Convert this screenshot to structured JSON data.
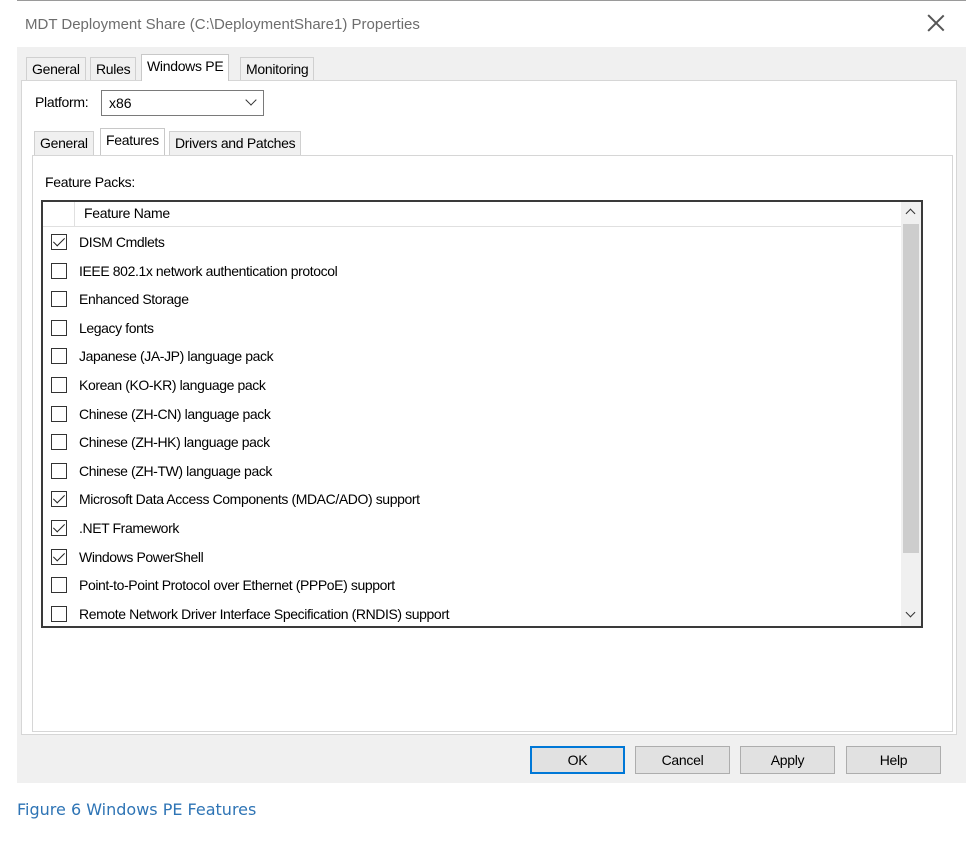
{
  "window": {
    "title": "MDT Deployment Share (C:\\DeploymentShare1) Properties"
  },
  "main_tabs": [
    {
      "label": "General"
    },
    {
      "label": "Rules"
    },
    {
      "label": "Windows PE"
    },
    {
      "label": "Monitoring"
    }
  ],
  "platform": {
    "label": "Platform:",
    "value": "x86"
  },
  "sub_tabs": [
    {
      "label": "General"
    },
    {
      "label": "Features"
    },
    {
      "label": "Drivers and Patches"
    }
  ],
  "feature_packs": {
    "label": "Feature Packs:",
    "column_header": "Feature Name",
    "items": [
      {
        "name": "DISM Cmdlets",
        "checked": true
      },
      {
        "name": "IEEE 802.1x network authentication protocol",
        "checked": false
      },
      {
        "name": "Enhanced Storage",
        "checked": false
      },
      {
        "name": "Legacy fonts",
        "checked": false
      },
      {
        "name": "Japanese (JA-JP) language pack",
        "checked": false
      },
      {
        "name": "Korean (KO-KR) language pack",
        "checked": false
      },
      {
        "name": "Chinese (ZH-CN) language pack",
        "checked": false
      },
      {
        "name": "Chinese (ZH-HK) language pack",
        "checked": false
      },
      {
        "name": "Chinese (ZH-TW) language pack",
        "checked": false
      },
      {
        "name": "Microsoft Data Access Components (MDAC/ADO) support",
        "checked": true
      },
      {
        "name": ".NET Framework",
        "checked": true
      },
      {
        "name": "Windows PowerShell",
        "checked": true
      },
      {
        "name": "Point-to-Point Protocol over Ethernet (PPPoE) support",
        "checked": false
      },
      {
        "name": "Remote Network Driver Interface Specification (RNDIS) support",
        "checked": false
      }
    ]
  },
  "buttons": {
    "ok": "OK",
    "cancel": "Cancel",
    "apply": "Apply",
    "help": "Help"
  },
  "caption": "Figure 6 Windows PE Features"
}
